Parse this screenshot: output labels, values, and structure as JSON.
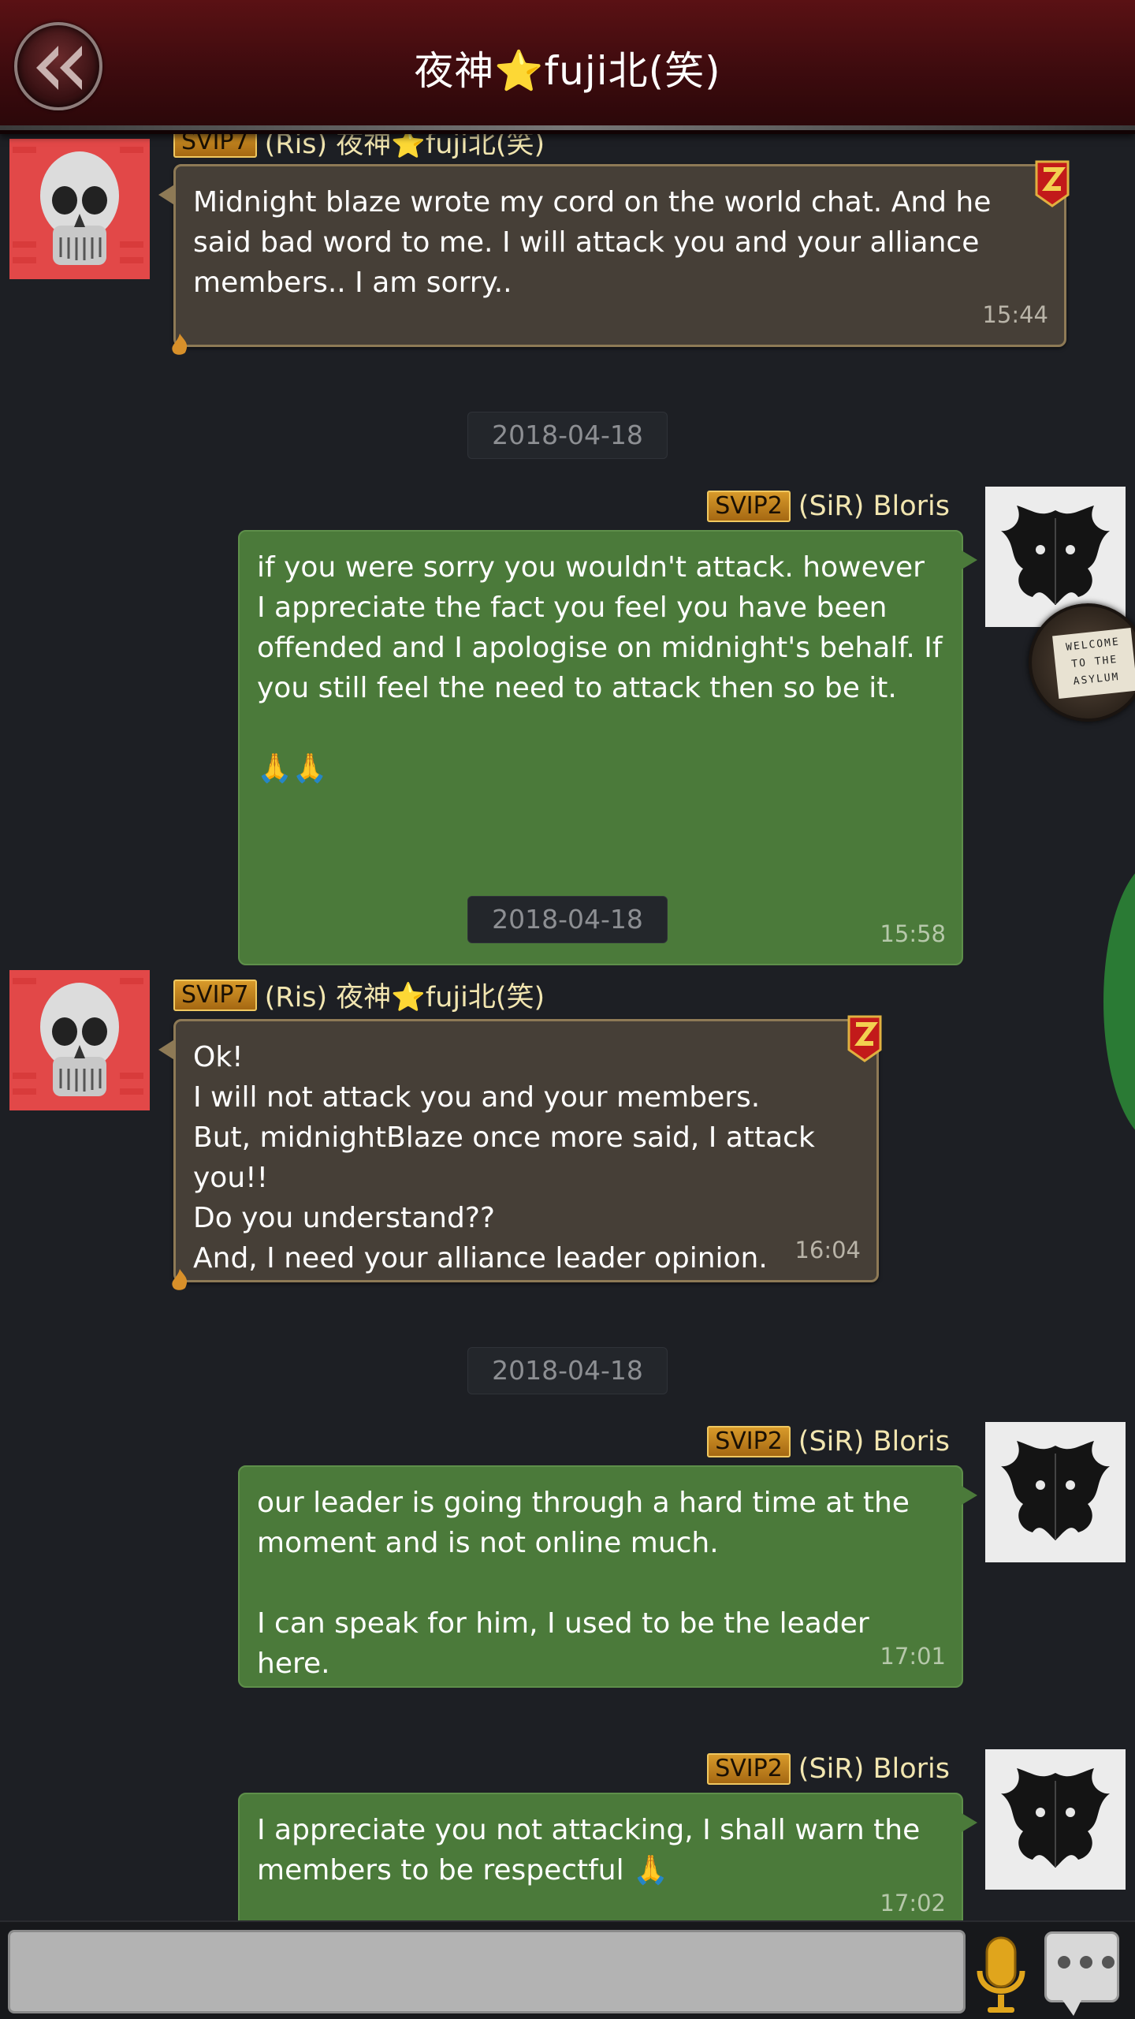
{
  "header": {
    "title": "夜神⭐fuji北(笑)"
  },
  "colors": {
    "header_bg": "#4a0e11",
    "brown_bubble": "#463f37",
    "green_bubble": "#4b7a3a",
    "vip_badge": "#c4821e",
    "name_text": "#f2e6b0"
  },
  "messages": [
    {
      "side": "left",
      "vip": "SVIP7",
      "name": "(Ris) 夜神⭐fuji北(笑)",
      "text": "Midnight blaze wrote my cord on the world chat. And he said bad word to me. I will attack you and your alliance members.. I am sorry..",
      "time": "15:44"
    },
    {
      "date": "2018-04-18"
    },
    {
      "side": "right",
      "vip": "SVIP2",
      "name": "(SiR) Bloris",
      "text": "if you were sorry you wouldn't attack. however\nI appreciate the fact you feel you have been offended and I apologise on midnight's behalf. If you still feel the need to attack then so be it.\n\n🙏🙏",
      "time": "15:58"
    },
    {
      "date": "2018-04-18"
    },
    {
      "side": "left",
      "vip": "SVIP7",
      "name": "(Ris) 夜神⭐fuji北(笑)",
      "text": "Ok!\nI will not attack you and your members.\nBut, midnightBlaze once more said, I attack you!!\nDo you understand??\nAnd, I need your alliance leader opinion.",
      "time": "16:04"
    },
    {
      "date": "2018-04-18"
    },
    {
      "side": "right",
      "vip": "SVIP2",
      "name": "(SiR) Bloris",
      "text": "our leader is going through a hard time at the moment and is not online much.\n\nI can speak for him, I used to be the leader here.",
      "time": "17:01"
    },
    {
      "side": "right",
      "vip": "SVIP2",
      "name": "(SiR) Bloris",
      "text": "I appreciate you not attacking, I shall warn the members to be respectful 🙏",
      "time": "17:02"
    }
  ],
  "welcome_sign": "WELCOME\nTO THE\nASYLUM",
  "input": {
    "value": "",
    "placeholder": ""
  }
}
